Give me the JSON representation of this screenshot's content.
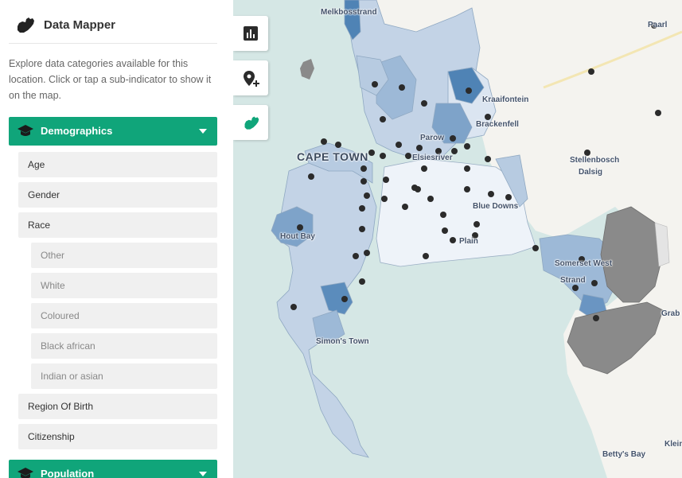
{
  "panel": {
    "title": "Data Mapper",
    "intro": "Explore data categories available for this location. Click or tap a sub-indicator to show it on the map.",
    "logo_icon": "south-africa-map-icon"
  },
  "categories": [
    {
      "label": "Demographics",
      "icon": "graduation-cap-icon",
      "color": "#10a57a"
    },
    {
      "label": "Population",
      "icon": "graduation-cap-icon",
      "color": "#10a57a"
    }
  ],
  "indicators": {
    "age": "Age",
    "gender": "Gender",
    "race": "Race",
    "race_sub": [
      "Other",
      "White",
      "Coloured",
      "Black african",
      "Indian or asian"
    ],
    "region_of_birth": "Region Of Birth",
    "citizenship": "Citizenship"
  },
  "map_tools": [
    "bar-chart-icon",
    "add-location-icon",
    "south-africa-map-icon"
  ],
  "map_labels": {
    "melkbosstrand": "Melkbosstrand",
    "paarl": "Paarl",
    "kraaifontein": "Kraaifontein",
    "brackenfell": "Brackenfell",
    "parow": "Parow",
    "cape_town": "CAPE TOWN",
    "elsiesriver": "Elsiesriver",
    "stellenbosch": "Stellenbosch",
    "dalsig": "Dalsig",
    "blue_downs": "Blue Downs",
    "hout_bay": "Hout Bay",
    "plain": "Plain",
    "somerset_west": "Somerset West",
    "strand": "Strand",
    "simons_town": "Simon's Town",
    "grabouw": "Grab",
    "bettys_bay": "Betty's Bay",
    "kleinmond": "Klein"
  },
  "colors": {
    "accent": "#10a57a",
    "water": "#d5e7e5",
    "land": "#f4f3ef",
    "choropleth_light": "#eef3f9",
    "choropleth_mid": "#b7cbe1",
    "choropleth_dark": "#4f83b5",
    "no_data": "#8a8a8a"
  }
}
